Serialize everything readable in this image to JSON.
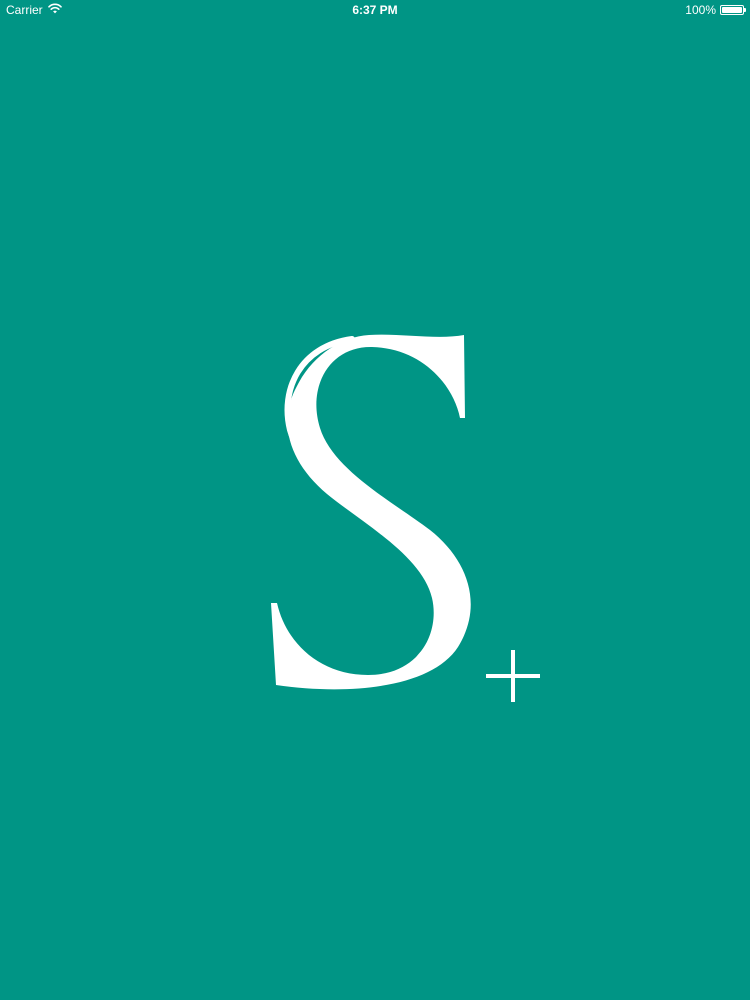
{
  "colors": {
    "background": "#009585",
    "status_text": "#ffffff",
    "logo_fill": "#ffffff",
    "logo_shadow": "#0b3b33"
  },
  "status_bar": {
    "carrier": "Carrier",
    "time": "6:37 PM",
    "battery_text": "100%",
    "battery_level": 1.0,
    "wifi_icon": "wifi-icon",
    "battery_icon": "battery-icon"
  },
  "splash": {
    "logo_icon": "s-plus-logo-icon"
  }
}
